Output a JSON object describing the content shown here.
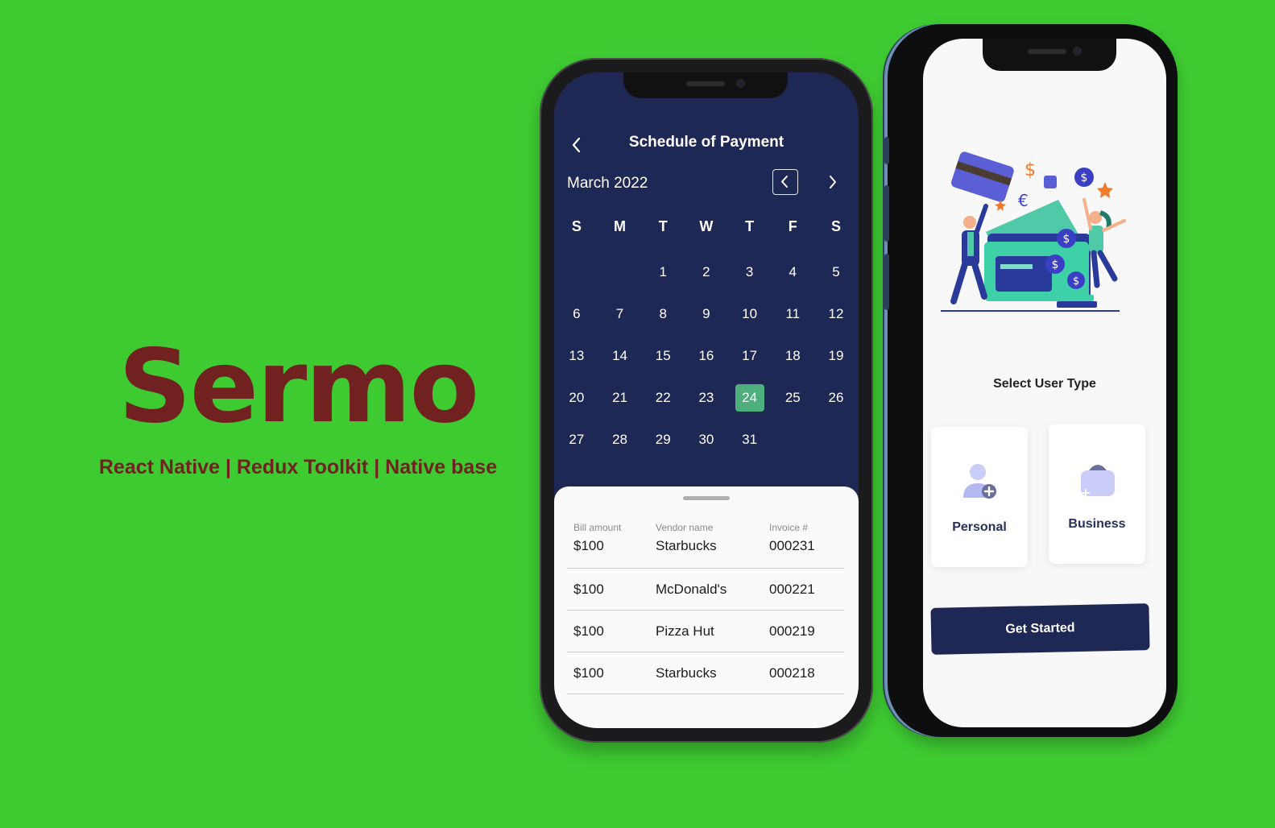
{
  "brand": {
    "title": "Sermo",
    "subtitle": "React Native | Redux Toolkit | Native base"
  },
  "schedule_screen": {
    "title": "Schedule of Payment",
    "back_icon": "chevron-left-icon",
    "month_label": "March 2022",
    "prev_month_icon": "chevron-left-icon",
    "next_month_icon": "chevron-right-icon",
    "weekday_headers": [
      "S",
      "M",
      "T",
      "W",
      "T",
      "F",
      "S"
    ],
    "weeks": [
      [
        "",
        "",
        "1",
        "2",
        "3",
        "4",
        "5"
      ],
      [
        "6",
        "7",
        "8",
        "9",
        "10",
        "11",
        "12"
      ],
      [
        "13",
        "14",
        "15",
        "16",
        "17",
        "18",
        "19"
      ],
      [
        "20",
        "21",
        "22",
        "23",
        "24",
        "25",
        "26"
      ],
      [
        "27",
        "28",
        "29",
        "30",
        "31",
        "",
        ""
      ]
    ],
    "selected_day": "24",
    "selected_color": "#4caf7d",
    "table": {
      "headers": [
        "Bill amount",
        "Vendor name",
        "Invoice #"
      ],
      "rows": [
        [
          "$100",
          "Starbucks",
          "000231"
        ],
        [
          "$100",
          "McDonald's",
          "000221"
        ],
        [
          "$100",
          "Pizza Hut",
          "000219"
        ],
        [
          "$100",
          "Starbucks",
          "000218"
        ]
      ]
    }
  },
  "user_type_screen": {
    "illustration": "payment-illustration",
    "title": "Select User Type",
    "options": [
      {
        "label": "Personal",
        "icon": "user-add-icon"
      },
      {
        "label": "Business",
        "icon": "briefcase-icon"
      }
    ],
    "cta_label": "Get Started"
  },
  "colors": {
    "background": "#3ecb32",
    "brand_text": "#722121",
    "navy": "#1f2855"
  }
}
